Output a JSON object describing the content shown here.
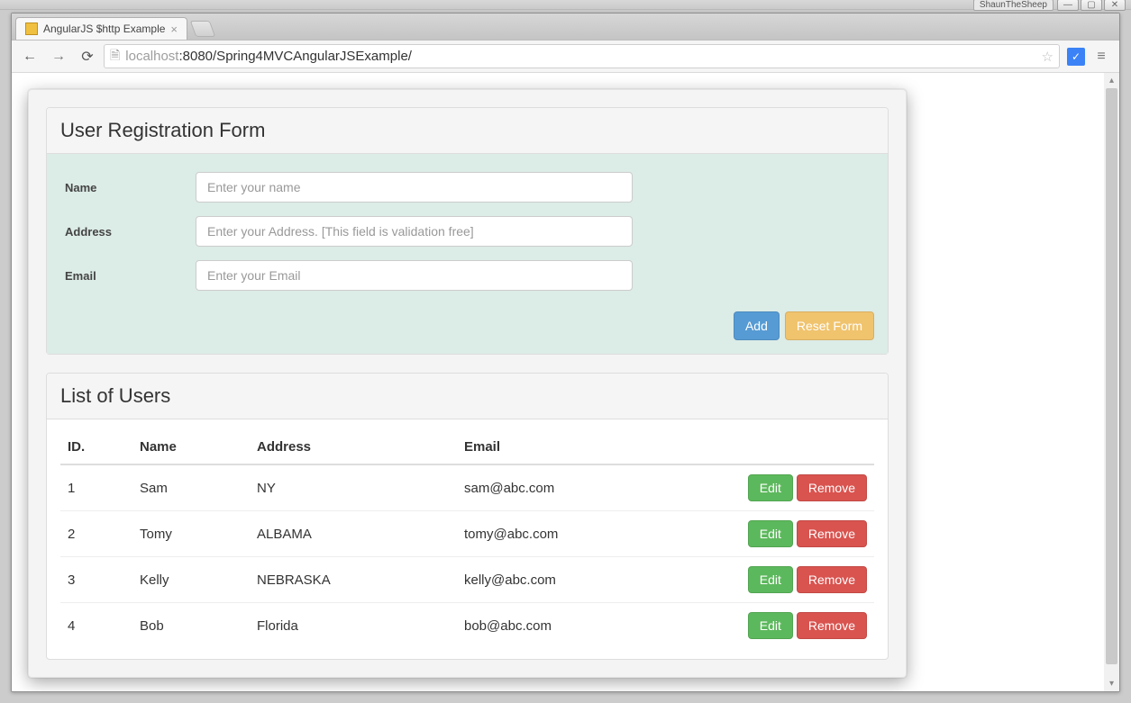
{
  "os": {
    "app_badge": "ShaunTheSheep",
    "minimize_glyph": "—",
    "maximize_glyph": "▢",
    "close_glyph": "✕"
  },
  "browser": {
    "tab_title": "AngularJS $http Example",
    "tab_close_glyph": "×",
    "back_glyph": "←",
    "forward_glyph": "→",
    "reload_glyph": "⟳",
    "page_icon_glyph": "🗎",
    "star_glyph": "☆",
    "menu_glyph": "≡",
    "url_host": "localhost",
    "url_port": ":8080",
    "url_path": "/Spring4MVCAngularJSExample/",
    "ext_glyph": "✓"
  },
  "form": {
    "panel_title": "User Registration Form",
    "name_label": "Name",
    "name_placeholder": "Enter your name",
    "address_label": "Address",
    "address_placeholder": "Enter your Address. [This field is validation free]",
    "email_label": "Email",
    "email_placeholder": "Enter your Email",
    "add_label": "Add",
    "reset_label": "Reset Form"
  },
  "list": {
    "panel_title": "List of Users",
    "columns": {
      "id": "ID.",
      "name": "Name",
      "address": "Address",
      "email": "Email"
    },
    "edit_label": "Edit",
    "remove_label": "Remove",
    "rows": [
      {
        "id": "1",
        "name": "Sam",
        "address": "NY",
        "email": "sam@abc.com"
      },
      {
        "id": "2",
        "name": "Tomy",
        "address": "ALBAMA",
        "email": "tomy@abc.com"
      },
      {
        "id": "3",
        "name": "Kelly",
        "address": "NEBRASKA",
        "email": "kelly@abc.com"
      },
      {
        "id": "4",
        "name": "Bob",
        "address": "Florida",
        "email": "bob@abc.com"
      }
    ]
  }
}
